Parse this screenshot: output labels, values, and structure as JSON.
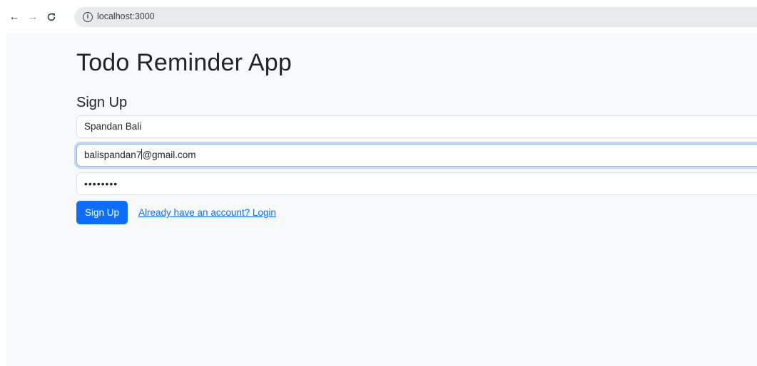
{
  "browser": {
    "back_icon": "←",
    "forward_icon": "→",
    "reload_icon": "C",
    "info_icon": "i",
    "url": "localhost:3000"
  },
  "app": {
    "title": "Todo Reminder App"
  },
  "form": {
    "title": "Sign Up",
    "name_value": "Spandan Bali",
    "email_value_before_caret": "balispandan7",
    "email_value_after_caret": "@gmail.com",
    "password_masked": "••••••••",
    "submit_label": "Sign Up",
    "login_link_label": "Already have an account? Login"
  }
}
